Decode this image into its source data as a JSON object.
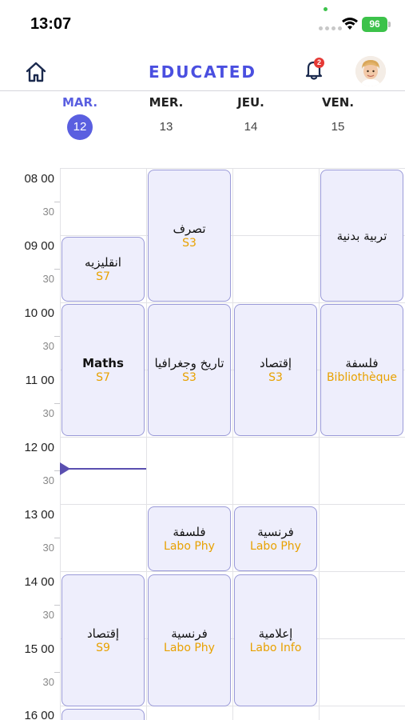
{
  "status_bar": {
    "time": "13:07",
    "battery": "96"
  },
  "header": {
    "brand": "EDUCATED",
    "notification_count": "2"
  },
  "days": [
    {
      "name": "MAR.",
      "number": "12",
      "active": true
    },
    {
      "name": "MER.",
      "number": "13",
      "active": false
    },
    {
      "name": "JEU.",
      "number": "14",
      "active": false
    },
    {
      "name": "VEN.",
      "number": "15",
      "active": false
    }
  ],
  "time_labels": {
    "h08": "08 00",
    "h08_30": "30",
    "h09": "09 00",
    "h09_30": "30",
    "h10": "10 00",
    "h10_30": "30",
    "h11": "11 00",
    "h11_30": "30",
    "h12": "12 00",
    "h12_30": "30",
    "h13": "13 00",
    "h13_30": "30",
    "h14": "14 00",
    "h14_30": "30",
    "h15": "15 00",
    "h15_30": "30",
    "h16": "16 00"
  },
  "events": {
    "e1": {
      "title": "تصرف",
      "room": "S3"
    },
    "e2": {
      "title": "تربية بدنية",
      "room": ""
    },
    "e3": {
      "title": "انقليزيه",
      "room": "S7"
    },
    "e4": {
      "title": "Maths",
      "room": "S7"
    },
    "e5": {
      "title": "تاريخ وجغرافيا",
      "room": "S3"
    },
    "e6": {
      "title": "إقتصاد",
      "room": "S3"
    },
    "e7": {
      "title": "فلسفة",
      "room": "Bibliothèque"
    },
    "e8": {
      "title": "فلسفة",
      "room": "Labo Phy"
    },
    "e9": {
      "title": "فرنسية",
      "room": "Labo Phy"
    },
    "e10": {
      "title": "إقتصاد",
      "room": "S9"
    },
    "e11": {
      "title": "فرنسية",
      "room": "Labo Phy"
    },
    "e12": {
      "title": "إعلامية",
      "room": "Labo Info"
    }
  },
  "colors": {
    "accent": "#5a5fe0",
    "room": "#e8a100",
    "event_bg": "#eeeefc",
    "event_border": "#9a9ad8",
    "now": "#5a4fb0"
  }
}
